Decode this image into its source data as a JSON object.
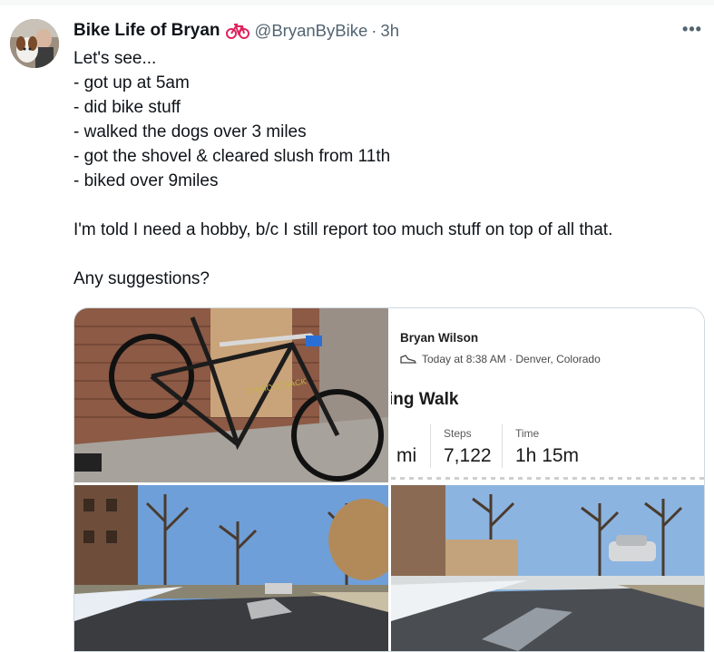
{
  "tweet": {
    "author_name": "Bike Life of Bryan",
    "handle": "@BryanByBike",
    "separator": "·",
    "time": "3h",
    "name_emoji": "bicycle-icon",
    "more_label": "•••",
    "lines": [
      "Let's see...",
      "- got up at 5am",
      "- did bike stuff",
      "- walked the dogs over 3 miles",
      "- got the shovel & cleared slush from 11th",
      "- biked over 9miles",
      "",
      "I'm told I need a hobby, b/c I still report too much stuff on top of all that.",
      "",
      "Any suggestions?"
    ]
  },
  "workout_card": {
    "user_name": "Bryan Wilson",
    "activity_icon": "shoe-icon",
    "meta": "Today at 8:38 AM · Denver, Colorado",
    "title_partial": "ing Walk",
    "distance_unit_partial": "mi",
    "steps_label": "Steps",
    "steps_value": "7,122",
    "time_label": "Time",
    "time_value": "1h 15m"
  },
  "colors": {
    "text_primary": "#0f1419",
    "text_secondary": "#536471",
    "border": "#cfd9de",
    "bike_red": "#e0245e"
  }
}
